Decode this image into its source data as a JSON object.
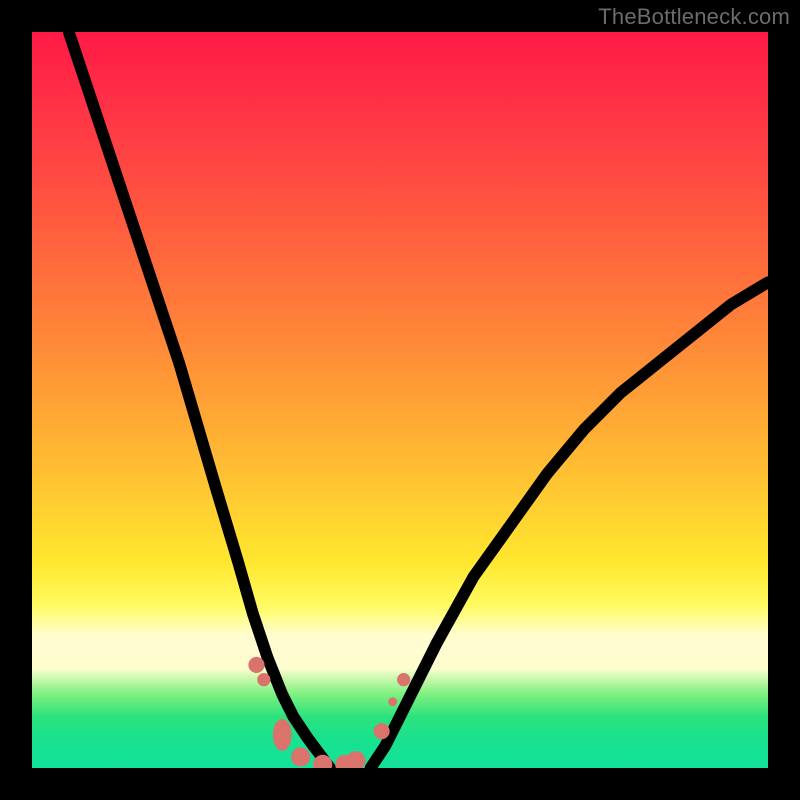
{
  "watermark": "TheBottleneck.com",
  "colors": {
    "background": "#000000",
    "watermark": "#6c6c6c",
    "curve": "#000000",
    "marker": "#d9736c"
  },
  "chart_data": {
    "type": "line",
    "title": "",
    "xlabel": "",
    "ylabel": "",
    "xlim": [
      0,
      100
    ],
    "ylim": [
      0,
      100
    ],
    "grid": false,
    "legend": false,
    "curves": [
      {
        "name": "left",
        "x": [
          5,
          10,
          15,
          20,
          25,
          28,
          30,
          32,
          34,
          35.5,
          37.5,
          40.5
        ],
        "y": [
          100,
          85,
          70,
          55,
          38,
          28,
          21,
          15,
          10,
          7,
          4,
          0
        ]
      },
      {
        "name": "right",
        "x": [
          46,
          48,
          50,
          52,
          55,
          60,
          65,
          70,
          75,
          80,
          85,
          90,
          95,
          100
        ],
        "y": [
          0,
          3,
          7,
          11,
          17,
          26,
          33,
          40,
          46,
          51,
          55,
          59,
          63,
          66
        ]
      }
    ],
    "markers": {
      "x": [
        30.5,
        31.5,
        34.0,
        36.5,
        39.5,
        42.5,
        44.0,
        47.5,
        49.0,
        50.5
      ],
      "y": [
        14.0,
        12.0,
        4.5,
        1.5,
        0.5,
        0.5,
        1.0,
        5.0,
        9.0,
        12.0
      ],
      "sizes": [
        1.1,
        0.9,
        1.8,
        1.3,
        1.3,
        1.3,
        1.3,
        1.1,
        0.6,
        0.9
      ]
    }
  }
}
